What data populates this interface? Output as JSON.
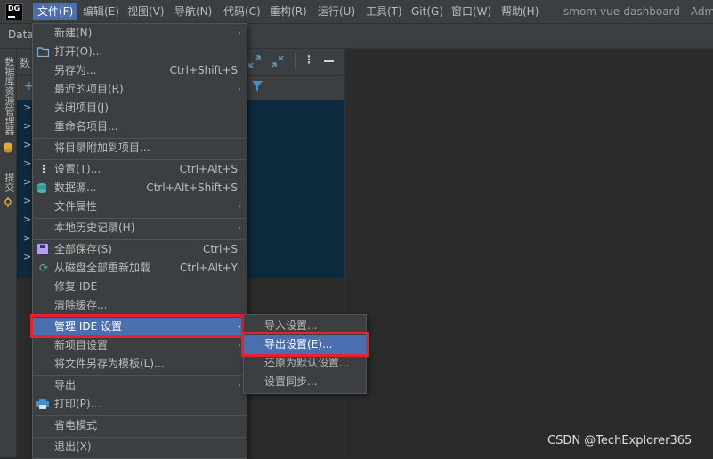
{
  "app": {
    "logo_text": "DG",
    "title": "smom-vue-dashboard - Adm"
  },
  "menubar": [
    {
      "label": "文件(F)"
    },
    {
      "label": "编辑(E)"
    },
    {
      "label": "视图(V)"
    },
    {
      "label": "导航(N)"
    },
    {
      "label": "代码(C)"
    },
    {
      "label": "重构(R)"
    },
    {
      "label": "运行(U)"
    },
    {
      "label": "工具(T)"
    },
    {
      "label": "Git(G)"
    },
    {
      "label": "窗口(W)"
    },
    {
      "label": "帮助(H)"
    }
  ],
  "navbar": {
    "crumb": "Data"
  },
  "left_tool": {
    "db_explorer": "数据库资源管理器",
    "commit": "提交"
  },
  "panel": {
    "header_fragment": "数"
  },
  "file_menu": {
    "items": [
      {
        "label": "新建(N)",
        "shortcut": "",
        "icon": "",
        "submenu": true
      },
      {
        "label": "打开(O)...",
        "shortcut": "",
        "icon": "folder-icon",
        "submenu": false
      },
      {
        "label": "另存为...",
        "shortcut": "Ctrl+Shift+S",
        "icon": "",
        "submenu": false
      },
      {
        "label": "最近的项目(R)",
        "shortcut": "",
        "icon": "",
        "submenu": true
      },
      {
        "label": "关闭项目(J)",
        "shortcut": "",
        "icon": "",
        "submenu": false
      },
      {
        "label": "重命名项目...",
        "shortcut": "",
        "icon": "",
        "submenu": false
      },
      {
        "label": "将目录附加到项目...",
        "shortcut": "",
        "icon": "",
        "submenu": false
      },
      {
        "label": "设置(T)...",
        "shortcut": "Ctrl+Alt+S",
        "icon": "settings-dots-icon",
        "submenu": false
      },
      {
        "label": "数据源...",
        "shortcut": "Ctrl+Alt+Shift+S",
        "icon": "datasource-icon",
        "submenu": false
      },
      {
        "label": "文件属性",
        "shortcut": "",
        "icon": "",
        "submenu": true
      },
      {
        "label": "本地历史记录(H)",
        "shortcut": "",
        "icon": "",
        "submenu": true
      },
      {
        "label": "全部保存(S)",
        "shortcut": "Ctrl+S",
        "icon": "save-icon",
        "submenu": false
      },
      {
        "label": "从磁盘全部重新加载",
        "shortcut": "Ctrl+Alt+Y",
        "icon": "reload-icon",
        "submenu": false
      },
      {
        "label": "修复 IDE",
        "shortcut": "",
        "icon": "",
        "submenu": false
      },
      {
        "label": "清除缓存...",
        "shortcut": "",
        "icon": "",
        "submenu": false
      },
      {
        "label": "管理 IDE 设置",
        "shortcut": "",
        "icon": "",
        "submenu": true
      },
      {
        "label": "新项目设置",
        "shortcut": "",
        "icon": "",
        "submenu": true
      },
      {
        "label": "将文件另存为模板(L)...",
        "shortcut": "",
        "icon": "",
        "submenu": false
      },
      {
        "label": "导出",
        "shortcut": "",
        "icon": "",
        "submenu": true
      },
      {
        "label": "打印(P)...",
        "shortcut": "",
        "icon": "print-icon",
        "submenu": false
      },
      {
        "label": "省电模式",
        "shortcut": "",
        "icon": "",
        "submenu": false
      },
      {
        "label": "退出(X)",
        "shortcut": "",
        "icon": "",
        "submenu": false
      }
    ]
  },
  "settings_submenu": {
    "items": [
      {
        "label": "导入设置..."
      },
      {
        "label": "导出设置(E)..."
      },
      {
        "label": "还原为默认设置..."
      },
      {
        "label": "设置同步..."
      }
    ]
  },
  "watermark": "CSDN @TechExplorer365",
  "colors": {
    "accent": "#4b6eaf",
    "highlight_box": "#e8202f",
    "tree_bg": "#0d293e"
  }
}
